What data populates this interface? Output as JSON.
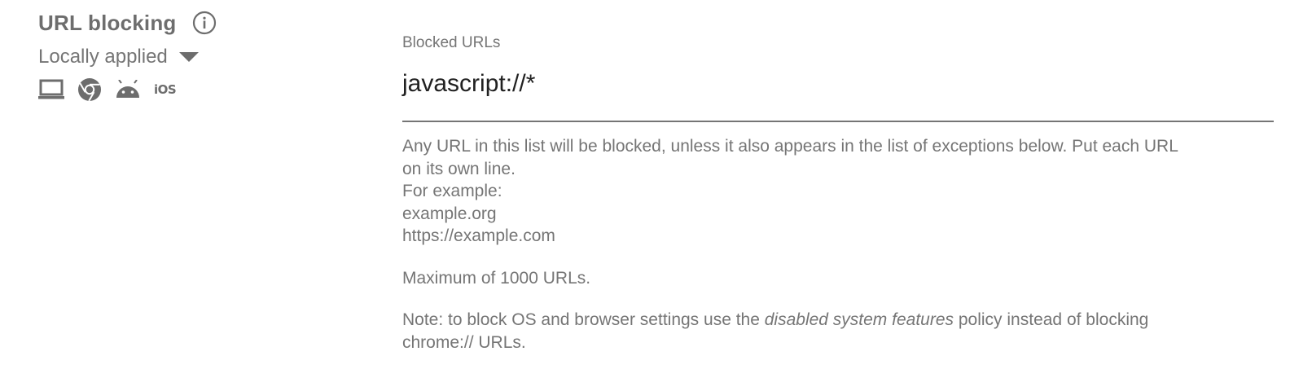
{
  "policy": {
    "title": "URL blocking",
    "scope_label": "Locally applied",
    "platforms": [
      "laptop-icon",
      "chrome-icon",
      "android-icon",
      "ios-icon"
    ],
    "ios_label": "iOS"
  },
  "field": {
    "label": "Blocked URLs",
    "value": "javascript://*"
  },
  "help": {
    "line1": "Any URL in this list will be blocked, unless it also appears in the list of exceptions below. Put each URL on its own line.",
    "example_heading": "For example:",
    "example1": "example.org",
    "example2": "https://example.com",
    "maximum": "Maximum of 1000 URLs.",
    "note_prefix": "Note: to block OS and browser settings use the ",
    "note_emphasis": "disabled system features",
    "note_suffix": " policy instead of blocking chrome:// URLs."
  },
  "colors": {
    "text_secondary": "#757575",
    "text_primary": "#212121",
    "icon": "#6d6d6d"
  }
}
